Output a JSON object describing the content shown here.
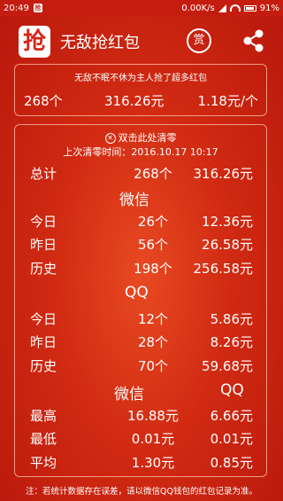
{
  "status": {
    "time": "20:49",
    "notification": "抢",
    "speed": "0.00K/s",
    "battery": "91%"
  },
  "app": {
    "logo": "抢",
    "title": "无敌抢红包",
    "reward_label": "赏"
  },
  "summary": {
    "title": "无敌不眠不休为主人抢了超多红包",
    "count": "268个",
    "amount": "316.26元",
    "average": "1.18元/个"
  },
  "stats": {
    "reset_label": "双击此处清零",
    "last_reset": "上次清零时间：2016.10.17 10:17",
    "total": {
      "label": "总计",
      "count": "268个",
      "amount": "316.26元"
    },
    "wechat": {
      "header": "微信",
      "rows": [
        {
          "label": "今日",
          "count": "26个",
          "amount": "12.36元"
        },
        {
          "label": "昨日",
          "count": "56个",
          "amount": "26.58元"
        },
        {
          "label": "历史",
          "count": "198个",
          "amount": "256.58元"
        }
      ]
    },
    "qq": {
      "header": "QQ",
      "rows": [
        {
          "label": "今日",
          "count": "12个",
          "amount": "5.86元"
        },
        {
          "label": "昨日",
          "count": "28个",
          "amount": "8.26元"
        },
        {
          "label": "历史",
          "count": "70个",
          "amount": "59.68元"
        }
      ]
    },
    "compare": {
      "header_wechat": "微信",
      "header_qq": "QQ",
      "rows": [
        {
          "label": "最高",
          "wechat": "16.88元",
          "qq": "6.66元"
        },
        {
          "label": "最低",
          "wechat": "0.01元",
          "qq": "0.01元"
        },
        {
          "label": "平均",
          "wechat": "1.30元",
          "qq": "0.85元"
        }
      ]
    }
  },
  "note": "注：若统计数据存在误差，请以微信QQ钱包的红包记录为准。"
}
